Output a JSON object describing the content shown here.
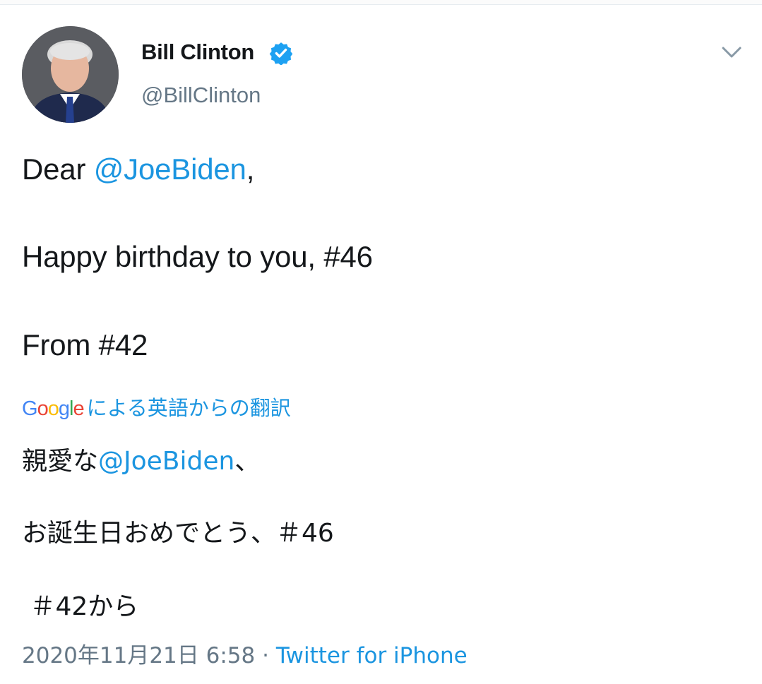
{
  "tweet": {
    "author": {
      "name": "Bill Clinton",
      "handle": "@BillClinton",
      "avatar": "portrait-photo",
      "verified_icon": "verified-badge-icon"
    },
    "menu_icon": "chevron-down-icon",
    "text": {
      "line1_prefix": "Dear ",
      "line1_mention": "@JoeBiden",
      "line1_suffix": ",",
      "line2": "Happy birthday to you, #46",
      "line3": "From #42"
    },
    "translation": {
      "provider_logo": [
        "G",
        "o",
        "o",
        "g",
        "l",
        "e"
      ],
      "label": "による英語からの翻訳",
      "line1_prefix": "親愛な",
      "line1_mention": "@JoeBiden",
      "line1_suffix": "、",
      "line2": "お誕生日おめでとう、＃46",
      "line3": " ＃42から"
    },
    "meta": {
      "timestamp": "2020年11月21日 6:58",
      "separator": " · ",
      "source": "Twitter for iPhone"
    }
  },
  "colors": {
    "accent": "#1b95e0",
    "text": "#14171a",
    "secondary": "#657786",
    "google_blue": "#4285f4",
    "google_red": "#ea4335",
    "google_yellow": "#fbbc05",
    "google_green": "#34a853"
  }
}
